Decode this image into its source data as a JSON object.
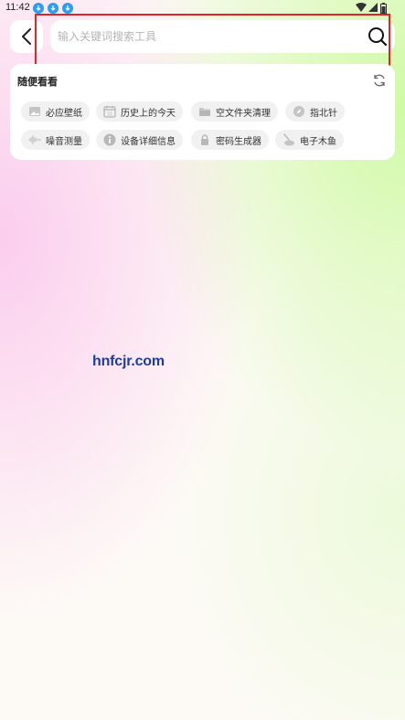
{
  "status_bar": {
    "time": "11:42"
  },
  "search": {
    "placeholder": "输入关键词搜索工具"
  },
  "random_section": {
    "title": "随便看看",
    "chips": [
      {
        "label": "必应壁纸",
        "icon": "image-icon"
      },
      {
        "label": "历史上的今天",
        "icon": "calendar-icon"
      },
      {
        "label": "空文件夹清理",
        "icon": "folder-icon"
      },
      {
        "label": "指北针",
        "icon": "compass-icon"
      },
      {
        "label": "噪音测量",
        "icon": "sound-wave-icon"
      },
      {
        "label": "设备详细信息",
        "icon": "info-icon"
      },
      {
        "label": "密码生成器",
        "icon": "lock-icon"
      },
      {
        "label": "电子木鱼",
        "icon": "wooden-fish-icon"
      }
    ]
  },
  "watermark": {
    "text": "hnfcjr.com"
  },
  "colors": {
    "highlight": "#e0242a",
    "chip_bg": "#f1f1f1",
    "download_icon": "#2e9cf3"
  }
}
